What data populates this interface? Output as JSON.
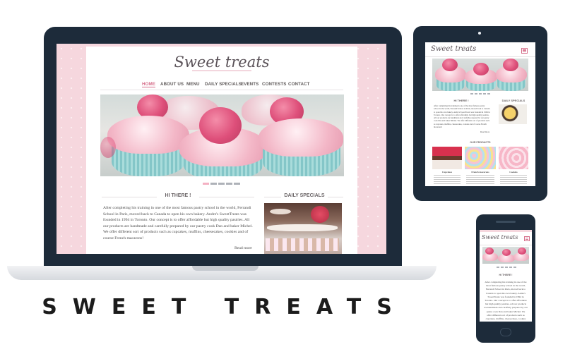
{
  "brand": {
    "logo": "Sweet treats"
  },
  "nav": [
    "HOME",
    "ABOUT US",
    "MENU",
    "DAILY SPECIALS",
    "EVENTS",
    "CONTESTS",
    "CONTACT"
  ],
  "hi_section": {
    "title": "HI THERE !",
    "body": "After completing his training in one of the most famous pastry school in the world, Ferrandi School in Paris, moved back to Canada to open his own bakery. Andre's SweetTreats was founded in 1994 in Toronto. Our concept is to offer affordable but high quality pastries. All our products are handmade and carefully prepared by our pastry cook Dan and baker Michel. We offer different sort of products such as cupcakes, muffins, cheesecakes, cookies and of course French macarons!",
    "read_more": "Read more"
  },
  "daily_specials": {
    "title": "DAILY SPECIALS"
  },
  "our_products": {
    "title": "OUR PRODUCTS",
    "items": [
      {
        "name": "Cupcakes"
      },
      {
        "name": "French macarons"
      },
      {
        "name": "Cookies"
      }
    ]
  },
  "headline": "SWEET TREATS",
  "colors": {
    "accent": "#d66f8b",
    "background_pink": "#f6d7de",
    "device_frame": "#1d2b3a"
  },
  "icons": [
    "hamburger-menu-icon",
    "camera-icon"
  ]
}
